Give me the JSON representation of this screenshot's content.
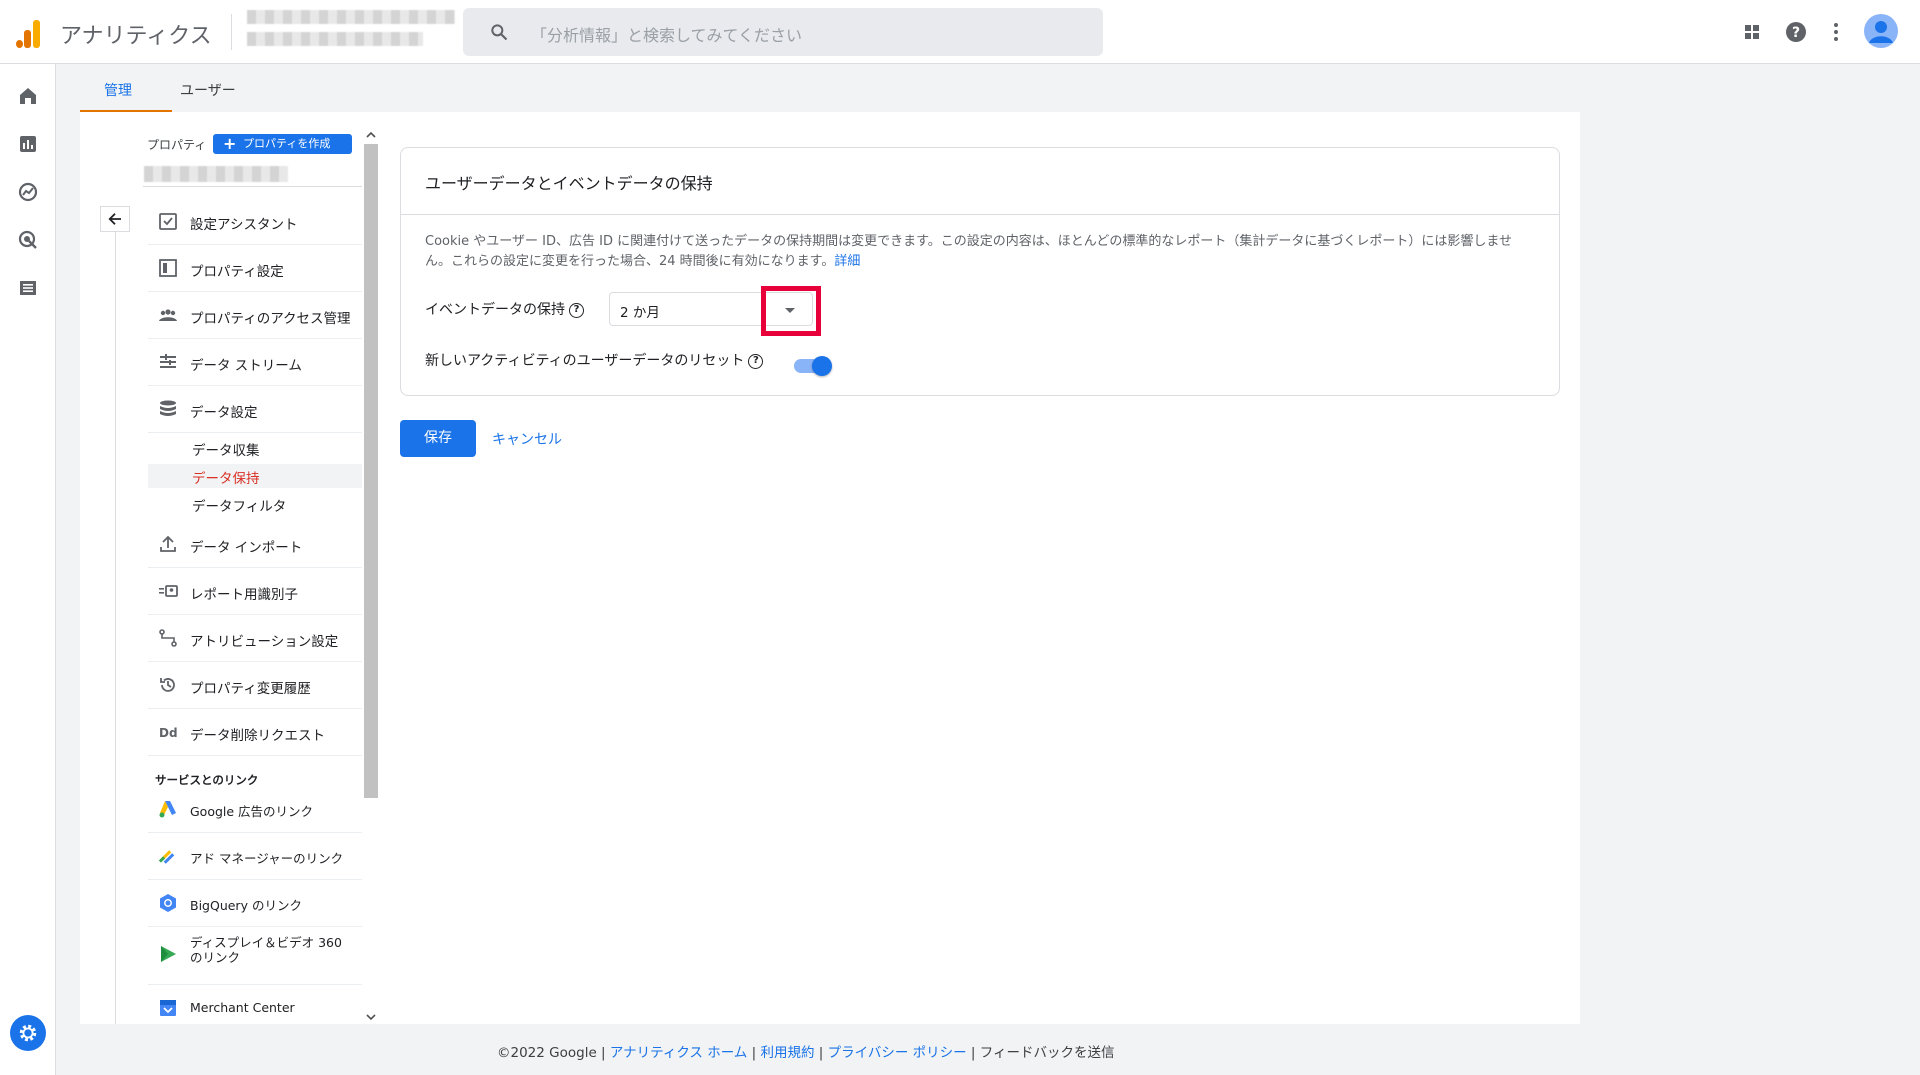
{
  "header": {
    "app_title": "アナリティクス",
    "search_placeholder": "「分析情報」と検索してみてください"
  },
  "tabs": [
    {
      "label": "管理",
      "active": true
    },
    {
      "label": "ユーザー",
      "active": false
    }
  ],
  "sidebar": {
    "property_label": "プロパティ",
    "create_property_label": "プロパティを作成",
    "items": [
      {
        "label": "設定アシスタント",
        "icon": "checklist-icon"
      },
      {
        "label": "プロパティ設定",
        "icon": "property-settings-icon"
      },
      {
        "label": "プロパティのアクセス管理",
        "icon": "people-icon"
      },
      {
        "label": "データ ストリーム",
        "icon": "streams-icon"
      },
      {
        "label": "データ設定",
        "icon": "database-icon"
      }
    ],
    "sub_items": [
      {
        "label": "データ収集",
        "active": false
      },
      {
        "label": "データ保持",
        "active": true
      },
      {
        "label": "データフィルタ",
        "active": false
      }
    ],
    "items2": [
      {
        "label": "データ インポート",
        "icon": "upload-icon"
      },
      {
        "label": "レポート用識別子",
        "icon": "identity-icon"
      },
      {
        "label": "アトリビューション設定",
        "icon": "attribution-icon"
      },
      {
        "label": "プロパティ変更履歴",
        "icon": "history-icon"
      },
      {
        "label": "データ削除リクエスト",
        "icon": "dd-icon"
      }
    ],
    "section_title": "サービスとのリンク",
    "links": [
      {
        "label": "Google 広告のリンク",
        "icon": "google-ads-icon"
      },
      {
        "label": "アド マネージャーのリンク",
        "icon": "ad-manager-icon"
      },
      {
        "label": "BigQuery のリンク",
        "icon": "bigquery-icon"
      },
      {
        "label": "ディスプレイ＆ビデオ 360 のリンク",
        "icon": "dv360-icon"
      },
      {
        "label": "Merchant Center",
        "icon": "merchant-center-icon"
      }
    ]
  },
  "card": {
    "title": "ユーザーデータとイベントデータの保持",
    "description": "Cookie やユーザー ID、広告 ID に関連付けて送ったデータの保持期間は変更できます。この設定の内容は、ほとんどの標準的なレポート（集計データに基づくレポート）には影響しません。これらの設定に変更を行った場合、24 時間後に有効になります。",
    "details_link": "詳細",
    "event_retention_label": "イベントデータの保持",
    "event_retention_value": "2 か月",
    "reset_label": "新しいアクティビティのユーザーデータのリセット",
    "reset_enabled": true
  },
  "actions": {
    "save": "保存",
    "cancel": "キャンセル"
  },
  "footer": {
    "copyright": "©2022 Google",
    "home": "アナリティクス ホーム",
    "terms": "利用規約",
    "privacy": "プライバシー ポリシー",
    "feedback": "フィードバックを送信"
  },
  "colors": {
    "primary": "#1a73e8",
    "highlight": "#e8003a",
    "active_sub": "#d93025",
    "tab_underline": "#e37400"
  }
}
